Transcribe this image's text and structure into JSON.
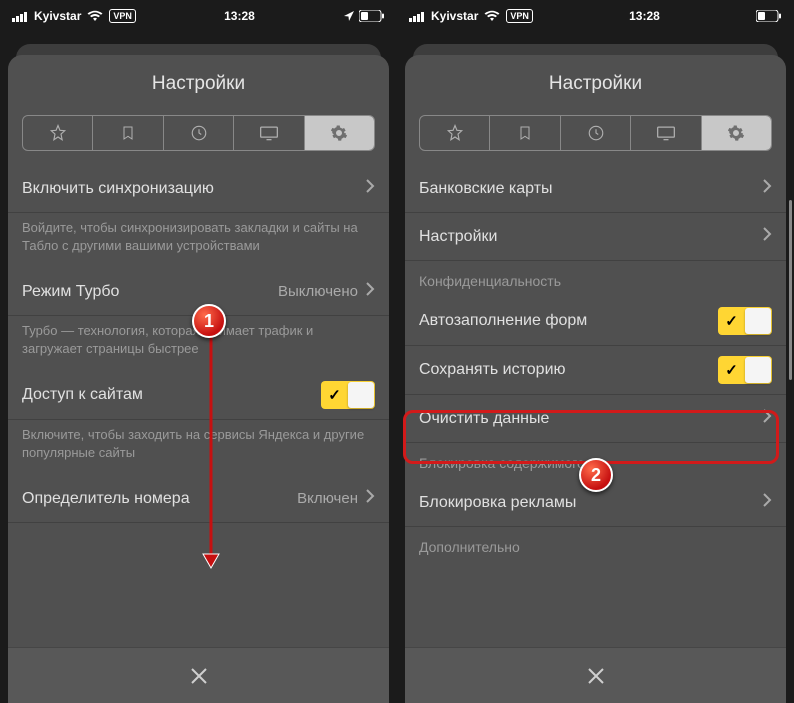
{
  "statusBar": {
    "carrier": "Kyivstar",
    "time": "13:28",
    "vpn": "VPN"
  },
  "left": {
    "title": "Настройки",
    "rows": {
      "sync": {
        "label": "Включить синхронизацию"
      },
      "syncDesc": "Войдите, чтобы синхронизировать закладки и сайты на Табло с другими вашими устройствами",
      "turbo": {
        "label": "Режим Турбо",
        "value": "Выключено"
      },
      "turboDesc": "Турбо — технология, которая сжимает трафик и загружает страницы быстрее",
      "access": {
        "label": "Доступ к сайтам"
      },
      "accessDesc": "Включите, чтобы заходить на сервисы Яндекса и другие популярные сайты",
      "callerId": {
        "label": "Определитель номера",
        "value": "Включен"
      }
    },
    "marker": "1"
  },
  "right": {
    "title": "Настройки",
    "rows": {
      "cards": {
        "label": "Банковские карты"
      },
      "settings": {
        "label": "Настройки"
      },
      "privacyH": "Конфиденциальность",
      "autofill": {
        "label": "Автозаполнение форм"
      },
      "history": {
        "label": "Сохранять историю"
      },
      "clear": {
        "label": "Очистить данные"
      },
      "blockH": "Блокировка содержимого",
      "adblock": {
        "label": "Блокировка рекламы"
      },
      "moreH": "Дополнительно"
    },
    "marker": "2"
  }
}
